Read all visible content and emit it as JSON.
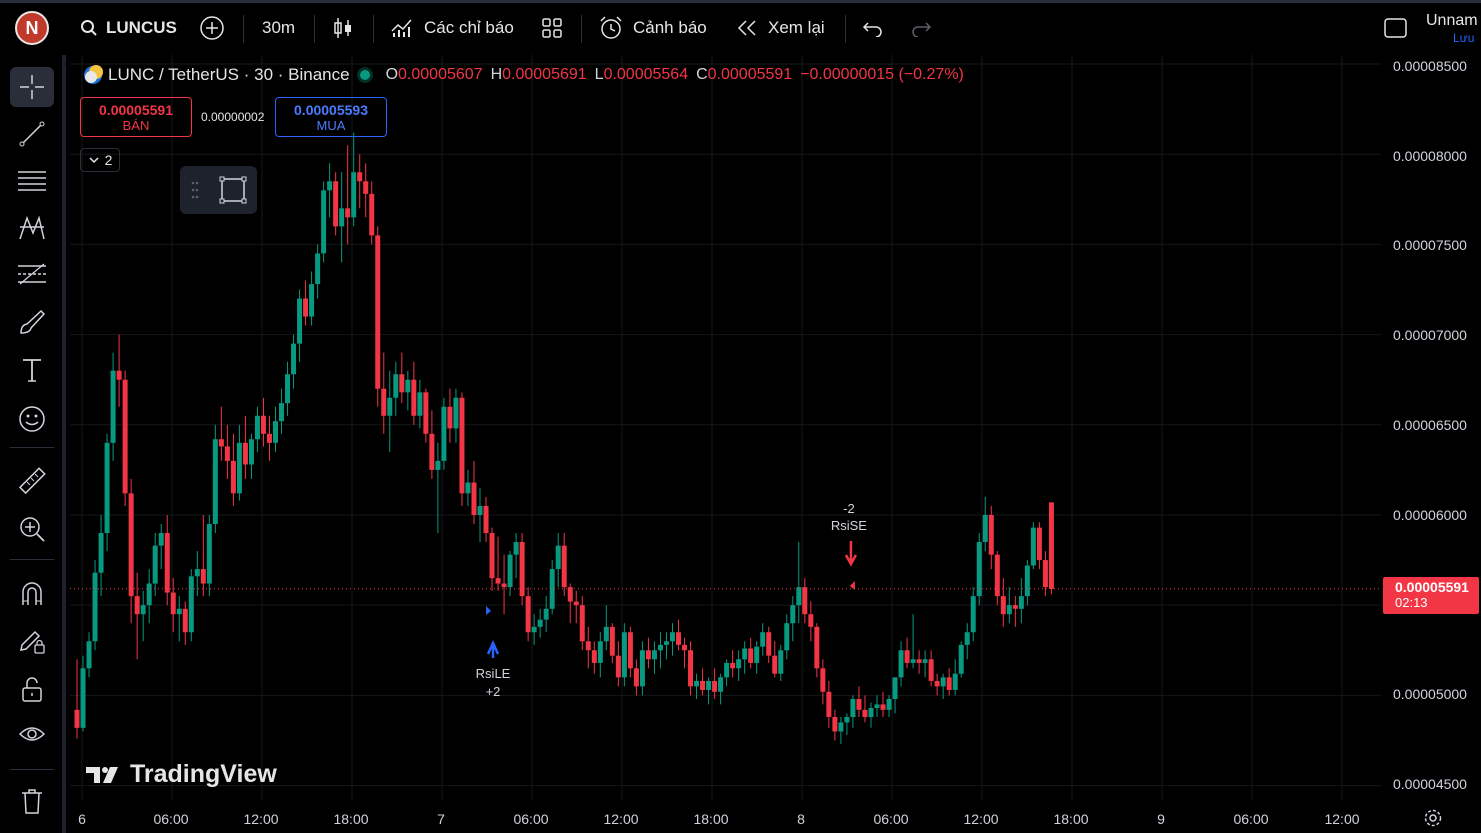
{
  "header": {
    "avatar_letter": "N",
    "symbol": "LUNCUSD",
    "timeframe": "30m",
    "indicators_label": "Các chỉ báo",
    "alerts_label": "Cảnh báo",
    "replay_label": "Xem lại",
    "layout_name": "Unnam",
    "save_label": "Lưu"
  },
  "legend": {
    "title": "LUNC / TetherUS · 30 · Binance",
    "open_key": "O",
    "open": "0.00005607",
    "high_key": "H",
    "high": "0.00005691",
    "low_key": "L",
    "low": "0.00005564",
    "close_key": "C",
    "close": "0.00005591",
    "change": "−0.00000015 (−0.27%)"
  },
  "trade": {
    "sell_price": "0.00005591",
    "sell_label": "BÁN",
    "spread": "0.00000002",
    "buy_price": "0.00005593",
    "buy_label": "MUA",
    "collapse_count": "2"
  },
  "price_axis": {
    "labels": [
      "0.00008500",
      "0.00008000",
      "0.00007500",
      "0.00007000",
      "0.00006500",
      "0.00006000",
      "0.00005000",
      "0.00004500"
    ],
    "current_price": "0.00005591",
    "countdown": "02:13"
  },
  "time_axis": {
    "labels": [
      "6",
      "06:00",
      "12:00",
      "18:00",
      "7",
      "06:00",
      "12:00",
      "18:00",
      "8",
      "06:00",
      "12:00",
      "18:00",
      "9",
      "06:00",
      "12:00"
    ]
  },
  "markers": {
    "long_label": "RsiLE",
    "long_qty": "+2",
    "short_label": "RsiSE",
    "short_qty": "-2"
  },
  "watermark": "TradingView",
  "colors": {
    "up": "#089981",
    "down": "#f23645",
    "buy": "#2962ff",
    "background": "#000000"
  },
  "chart_data": {
    "type": "candlestick",
    "y_range": [
      4.42e-05,
      8.55e-05
    ],
    "candles": [
      [
        4.92e-05,
        5.2e-05,
        4.76e-05,
        4.82e-05
      ],
      [
        4.82e-05,
        5.22e-05,
        4.8e-05,
        5.15e-05
      ],
      [
        5.15e-05,
        5.35e-05,
        5.1e-05,
        5.3e-05
      ],
      [
        5.3e-05,
        5.75e-05,
        5.25e-05,
        5.68e-05
      ],
      [
        5.68e-05,
        6e-05,
        5.55e-05,
        5.9e-05
      ],
      [
        5.9e-05,
        6.45e-05,
        5.8e-05,
        6.4e-05
      ],
      [
        6.4e-05,
        6.9e-05,
        6.3e-05,
        6.8e-05
      ],
      [
        6.8e-05,
        7e-05,
        6.6e-05,
        6.75e-05
      ],
      [
        6.75e-05,
        6.8e-05,
        6.05e-05,
        6.12e-05
      ],
      [
        6.12e-05,
        6.2e-05,
        5.4e-05,
        5.55e-05
      ],
      [
        5.55e-05,
        5.68e-05,
        5.2e-05,
        5.45e-05
      ],
      [
        5.45e-05,
        5.58e-05,
        5.3e-05,
        5.5e-05
      ],
      [
        5.5e-05,
        5.7e-05,
        5.4e-05,
        5.62e-05
      ],
      [
        5.62e-05,
        5.9e-05,
        5.55e-05,
        5.83e-05
      ],
      [
        5.83e-05,
        5.95e-05,
        5.7e-05,
        5.9e-05
      ],
      [
        5.9e-05,
        6e-05,
        5.5e-05,
        5.57e-05
      ],
      [
        5.57e-05,
        5.65e-05,
        5.35e-05,
        5.45e-05
      ],
      [
        5.45e-05,
        5.55e-05,
        5.3e-05,
        5.48e-05
      ],
      [
        5.48e-05,
        5.52e-05,
        5.28e-05,
        5.35e-05
      ],
      [
        5.35e-05,
        5.7e-05,
        5.3e-05,
        5.66e-05
      ],
      [
        5.66e-05,
        5.8e-05,
        5.55e-05,
        5.7e-05
      ],
      [
        5.7e-05,
        6e-05,
        5.55e-05,
        5.62e-05
      ],
      [
        5.62e-05,
        6e-05,
        5.55e-05,
        5.95e-05
      ],
      [
        5.95e-05,
        6.5e-05,
        5.9e-05,
        6.42e-05
      ],
      [
        6.42e-05,
        6.6e-05,
        6.3e-05,
        6.38e-05
      ],
      [
        6.38e-05,
        6.5e-05,
        6.2e-05,
        6.3e-05
      ],
      [
        6.3e-05,
        6.45e-05,
        6.05e-05,
        6.12e-05
      ],
      [
        6.12e-05,
        6.5e-05,
        6.08e-05,
        6.4e-05
      ],
      [
        6.4e-05,
        6.55e-05,
        6.2e-05,
        6.28e-05
      ],
      [
        6.28e-05,
        6.45e-05,
        6.2e-05,
        6.42e-05
      ],
      [
        6.42e-05,
        6.6e-05,
        6.35e-05,
        6.55e-05
      ],
      [
        6.55e-05,
        6.65e-05,
        6.38e-05,
        6.45e-05
      ],
      [
        6.45e-05,
        6.55e-05,
        6.3e-05,
        6.4e-05
      ],
      [
        6.4e-05,
        6.6e-05,
        6.35e-05,
        6.52e-05
      ],
      [
        6.52e-05,
        6.7e-05,
        6.45e-05,
        6.62e-05
      ],
      [
        6.62e-05,
        6.85e-05,
        6.55e-05,
        6.78e-05
      ],
      [
        6.78e-05,
        7e-05,
        6.7e-05,
        6.95e-05
      ],
      [
        6.95e-05,
        7.25e-05,
        6.85e-05,
        7.2e-05
      ],
      [
        7.2e-05,
        7.3e-05,
        7.05e-05,
        7.1e-05
      ],
      [
        7.1e-05,
        7.35e-05,
        7.05e-05,
        7.28e-05
      ],
      [
        7.28e-05,
        7.5e-05,
        7.2e-05,
        7.45e-05
      ],
      [
        7.45e-05,
        7.85e-05,
        7.4e-05,
        7.8e-05
      ],
      [
        7.8e-05,
        7.95e-05,
        7.65e-05,
        7.85e-05
      ],
      [
        7.85e-05,
        7.9e-05,
        7.55e-05,
        7.6e-05
      ],
      [
        7.6e-05,
        7.9e-05,
        7.4e-05,
        7.7e-05
      ],
      [
        7.7e-05,
        8.05e-05,
        7.5e-05,
        7.65e-05
      ],
      [
        7.65e-05,
        8.12e-05,
        7.6e-05,
        7.9e-05
      ],
      [
        7.9e-05,
        8e-05,
        7.7e-05,
        7.85e-05
      ],
      [
        7.85e-05,
        7.95e-05,
        7.65e-05,
        7.78e-05
      ],
      [
        7.78e-05,
        7.85e-05,
        7.5e-05,
        7.55e-05
      ],
      [
        7.55e-05,
        7.6e-05,
        6.6e-05,
        6.7e-05
      ],
      [
        6.7e-05,
        6.9e-05,
        6.45e-05,
        6.55e-05
      ],
      [
        6.55e-05,
        6.8e-05,
        6.35e-05,
        6.65e-05
      ],
      [
        6.65e-05,
        6.85e-05,
        6.55e-05,
        6.78e-05
      ],
      [
        6.78e-05,
        6.9e-05,
        6.62e-05,
        6.68e-05
      ],
      [
        6.68e-05,
        6.8e-05,
        6.58e-05,
        6.75e-05
      ],
      [
        6.75e-05,
        6.85e-05,
        6.5e-05,
        6.55e-05
      ],
      [
        6.55e-05,
        6.75e-05,
        6.48e-05,
        6.68e-05
      ],
      [
        6.68e-05,
        6.7e-05,
        6.4e-05,
        6.45e-05
      ],
      [
        6.45e-05,
        6.58e-05,
        6.2e-05,
        6.25e-05
      ],
      [
        6.25e-05,
        6.4e-05,
        5.9e-05,
        6.3e-05
      ],
      [
        6.3e-05,
        6.65e-05,
        6.25e-05,
        6.6e-05
      ],
      [
        6.6e-05,
        6.7e-05,
        6.4e-05,
        6.48e-05
      ],
      [
        6.48e-05,
        6.7e-05,
        6.4e-05,
        6.65e-05
      ],
      [
        6.65e-05,
        6.68e-05,
        6.05e-05,
        6.12e-05
      ],
      [
        6.12e-05,
        6.25e-05,
        6.05e-05,
        6.18e-05
      ],
      [
        6.18e-05,
        6.3e-05,
        5.95e-05,
        6e-05
      ],
      [
        6e-05,
        6.15e-05,
        5.85e-05,
        6.05e-05
      ],
      [
        6.05e-05,
        6.1e-05,
        5.85e-05,
        5.9e-05
      ],
      [
        5.9e-05,
        5.93e-05,
        5.58e-05,
        5.65e-05
      ],
      [
        5.65e-05,
        5.88e-05,
        5.58e-05,
        5.62e-05
      ],
      [
        5.62e-05,
        5.78e-05,
        5.45e-05,
        5.6e-05
      ],
      [
        5.6e-05,
        5.8e-05,
        5.55e-05,
        5.78e-05
      ],
      [
        5.78e-05,
        5.9e-05,
        5.65e-05,
        5.85e-05
      ],
      [
        5.85e-05,
        5.9e-05,
        5.5e-05,
        5.55e-05
      ],
      [
        5.55e-05,
        5.6e-05,
        5.3e-05,
        5.35e-05
      ],
      [
        5.35e-05,
        5.45e-05,
        5.28e-05,
        5.38e-05
      ],
      [
        5.38e-05,
        5.48e-05,
        5.32e-05,
        5.42e-05
      ],
      [
        5.42e-05,
        5.55e-05,
        5.35e-05,
        5.48e-05
      ],
      [
        5.48e-05,
        5.75e-05,
        5.45e-05,
        5.7e-05
      ],
      [
        5.7e-05,
        5.9e-05,
        5.6e-05,
        5.83e-05
      ],
      [
        5.83e-05,
        5.9e-05,
        5.55e-05,
        5.6e-05
      ],
      [
        5.6e-05,
        5.62e-05,
        5.4e-05,
        5.52e-05
      ],
      [
        5.52e-05,
        5.58e-05,
        5.4e-05,
        5.5e-05
      ],
      [
        5.5e-05,
        5.55e-05,
        5.25e-05,
        5.3e-05
      ],
      [
        5.3e-05,
        5.38e-05,
        5.15e-05,
        5.25e-05
      ],
      [
        5.25e-05,
        5.3e-05,
        5.12e-05,
        5.18e-05
      ],
      [
        5.18e-05,
        5.35e-05,
        5.1e-05,
        5.3e-05
      ],
      [
        5.3e-05,
        5.5e-05,
        5.25e-05,
        5.38e-05
      ],
      [
        5.38e-05,
        5.4e-05,
        5.18e-05,
        5.22e-05
      ],
      [
        5.22e-05,
        5.3e-05,
        5.05e-05,
        5.1e-05
      ],
      [
        5.1e-05,
        5.4e-05,
        5.05e-05,
        5.35e-05
      ],
      [
        5.35e-05,
        5.38e-05,
        5.1e-05,
        5.15e-05
      ],
      [
        5.15e-05,
        5.2e-05,
        5e-05,
        5.05e-05
      ],
      [
        5.05e-05,
        5.3e-05,
        5e-05,
        5.25e-05
      ],
      [
        5.25e-05,
        5.32e-05,
        5.15e-05,
        5.2e-05
      ],
      [
        5.2e-05,
        5.3e-05,
        5.12e-05,
        5.25e-05
      ],
      [
        5.25e-05,
        5.35e-05,
        5.15e-05,
        5.28e-05
      ],
      [
        5.28e-05,
        5.35e-05,
        5.2e-05,
        5.3e-05
      ],
      [
        5.3e-05,
        5.4e-05,
        5.22e-05,
        5.35e-05
      ],
      [
        5.35e-05,
        5.42e-05,
        5.25e-05,
        5.28e-05
      ],
      [
        5.28e-05,
        5.32e-05,
        5.15e-05,
        5.25e-05
      ],
      [
        5.25e-05,
        5.3e-05,
        5e-05,
        5.05e-05
      ],
      [
        5.05e-05,
        5.12e-05,
        4.98e-05,
        5.08e-05
      ],
      [
        5.08e-05,
        5.15e-05,
        5e-05,
        5.03e-05
      ],
      [
        5.03e-05,
        5.1e-05,
        4.95e-05,
        5.08e-05
      ],
      [
        5.08e-05,
        5.15e-05,
        4.98e-05,
        5.02e-05
      ],
      [
        5.02e-05,
        5.12e-05,
        4.95e-05,
        5.1e-05
      ],
      [
        5.1e-05,
        5.2e-05,
        5.05e-05,
        5.18e-05
      ],
      [
        5.18e-05,
        5.25e-05,
        5.1e-05,
        5.15e-05
      ],
      [
        5.15e-05,
        5.25e-05,
        5.08e-05,
        5.2e-05
      ],
      [
        5.2e-05,
        5.3e-05,
        5.12e-05,
        5.26e-05
      ],
      [
        5.26e-05,
        5.32e-05,
        5.15e-05,
        5.18e-05
      ],
      [
        5.18e-05,
        5.3e-05,
        5.12e-05,
        5.27e-05
      ],
      [
        5.27e-05,
        5.4e-05,
        5.22e-05,
        5.35e-05
      ],
      [
        5.35e-05,
        5.38e-05,
        5.18e-05,
        5.22e-05
      ],
      [
        5.22e-05,
        5.3e-05,
        5.1e-05,
        5.12e-05
      ],
      [
        5.12e-05,
        5.28e-05,
        5.08e-05,
        5.25e-05
      ],
      [
        5.25e-05,
        5.45e-05,
        5.2e-05,
        5.4e-05
      ],
      [
        5.4e-05,
        5.55e-05,
        5.3e-05,
        5.5e-05
      ],
      [
        5.5e-05,
        5.85e-05,
        5.4e-05,
        5.6e-05
      ],
      [
        5.6e-05,
        5.65e-05,
        5.4e-05,
        5.45e-05
      ],
      [
        5.45e-05,
        5.52e-05,
        5.3e-05,
        5.38e-05
      ],
      [
        5.38e-05,
        5.4e-05,
        5.1e-05,
        5.15e-05
      ],
      [
        5.15e-05,
        5.2e-05,
        4.95e-05,
        5.02e-05
      ],
      [
        5.02e-05,
        5.08e-05,
        4.82e-05,
        4.88e-05
      ],
      [
        4.88e-05,
        4.92e-05,
        4.75e-05,
        4.8e-05
      ],
      [
        4.8e-05,
        4.88e-05,
        4.73e-05,
        4.85e-05
      ],
      [
        4.85e-05,
        4.9e-05,
        4.78e-05,
        4.88e-05
      ],
      [
        4.88e-05,
        5e-05,
        4.82e-05,
        4.98e-05
      ],
      [
        4.98e-05,
        5.05e-05,
        4.88e-05,
        4.92e-05
      ],
      [
        4.92e-05,
        5e-05,
        4.85e-05,
        4.88e-05
      ],
      [
        4.88e-05,
        4.96e-05,
        4.82e-05,
        4.93e-05
      ],
      [
        4.93e-05,
        5e-05,
        4.88e-05,
        4.95e-05
      ],
      [
        4.95e-05,
        5.02e-05,
        4.88e-05,
        4.92e-05
      ],
      [
        4.92e-05,
        5e-05,
        4.88e-05,
        4.98e-05
      ],
      [
        4.98e-05,
        5.1e-05,
        4.9e-05,
        5.1e-05
      ],
      [
        5.1e-05,
        5.3e-05,
        5.05e-05,
        5.25e-05
      ],
      [
        5.25e-05,
        5.32e-05,
        5.15e-05,
        5.18e-05
      ],
      [
        5.18e-05,
        5.45e-05,
        5.15e-05,
        5.2e-05
      ],
      [
        5.2e-05,
        5.25e-05,
        5.12e-05,
        5.18e-05
      ],
      [
        5.18e-05,
        5.25e-05,
        5.1e-05,
        5.2e-05
      ],
      [
        5.2e-05,
        5.25e-05,
        5.05e-05,
        5.08e-05
      ],
      [
        5.08e-05,
        5.12e-05,
        5e-05,
        5.05e-05
      ],
      [
        5.05e-05,
        5.12e-05,
        4.98e-05,
        5.1e-05
      ],
      [
        5.1e-05,
        5.15e-05,
        5e-05,
        5.03e-05
      ],
      [
        5.03e-05,
        5.2e-05,
        5e-05,
        5.12e-05
      ],
      [
        5.12e-05,
        5.3e-05,
        5.1e-05,
        5.28e-05
      ],
      [
        5.28e-05,
        5.4e-05,
        5.2e-05,
        5.35e-05
      ],
      [
        5.35e-05,
        5.6e-05,
        5.3e-05,
        5.55e-05
      ],
      [
        5.55e-05,
        5.9e-05,
        5.5e-05,
        5.85e-05
      ],
      [
        5.85e-05,
        6.1e-05,
        5.8e-05,
        6e-05
      ],
      [
        6e-05,
        6.05e-05,
        5.7e-05,
        5.78e-05
      ],
      [
        5.78e-05,
        5.8e-05,
        5.5e-05,
        5.55e-05
      ],
      [
        5.55e-05,
        5.65e-05,
        5.38e-05,
        5.45e-05
      ],
      [
        5.45e-05,
        5.6e-05,
        5.4e-05,
        5.5e-05
      ],
      [
        5.5e-05,
        5.55e-05,
        5.38e-05,
        5.48e-05
      ],
      [
        5.48e-05,
        5.65e-05,
        5.4e-05,
        5.55e-05
      ],
      [
        5.55e-05,
        5.75e-05,
        5.5e-05,
        5.72e-05
      ],
      [
        5.72e-05,
        5.96e-05,
        5.7e-05,
        5.93e-05
      ],
      [
        5.93e-05,
        5.96e-05,
        5.7e-05,
        5.75e-05
      ],
      [
        5.75e-05,
        5.8e-05,
        5.55e-05,
        5.6e-05
      ],
      [
        6.07e-05,
        5.69e-05,
        5.56e-05,
        5.59e-05
      ]
    ],
    "current_price": 5.591e-05,
    "long_entry_index": 68,
    "short_entry_index": 128
  }
}
